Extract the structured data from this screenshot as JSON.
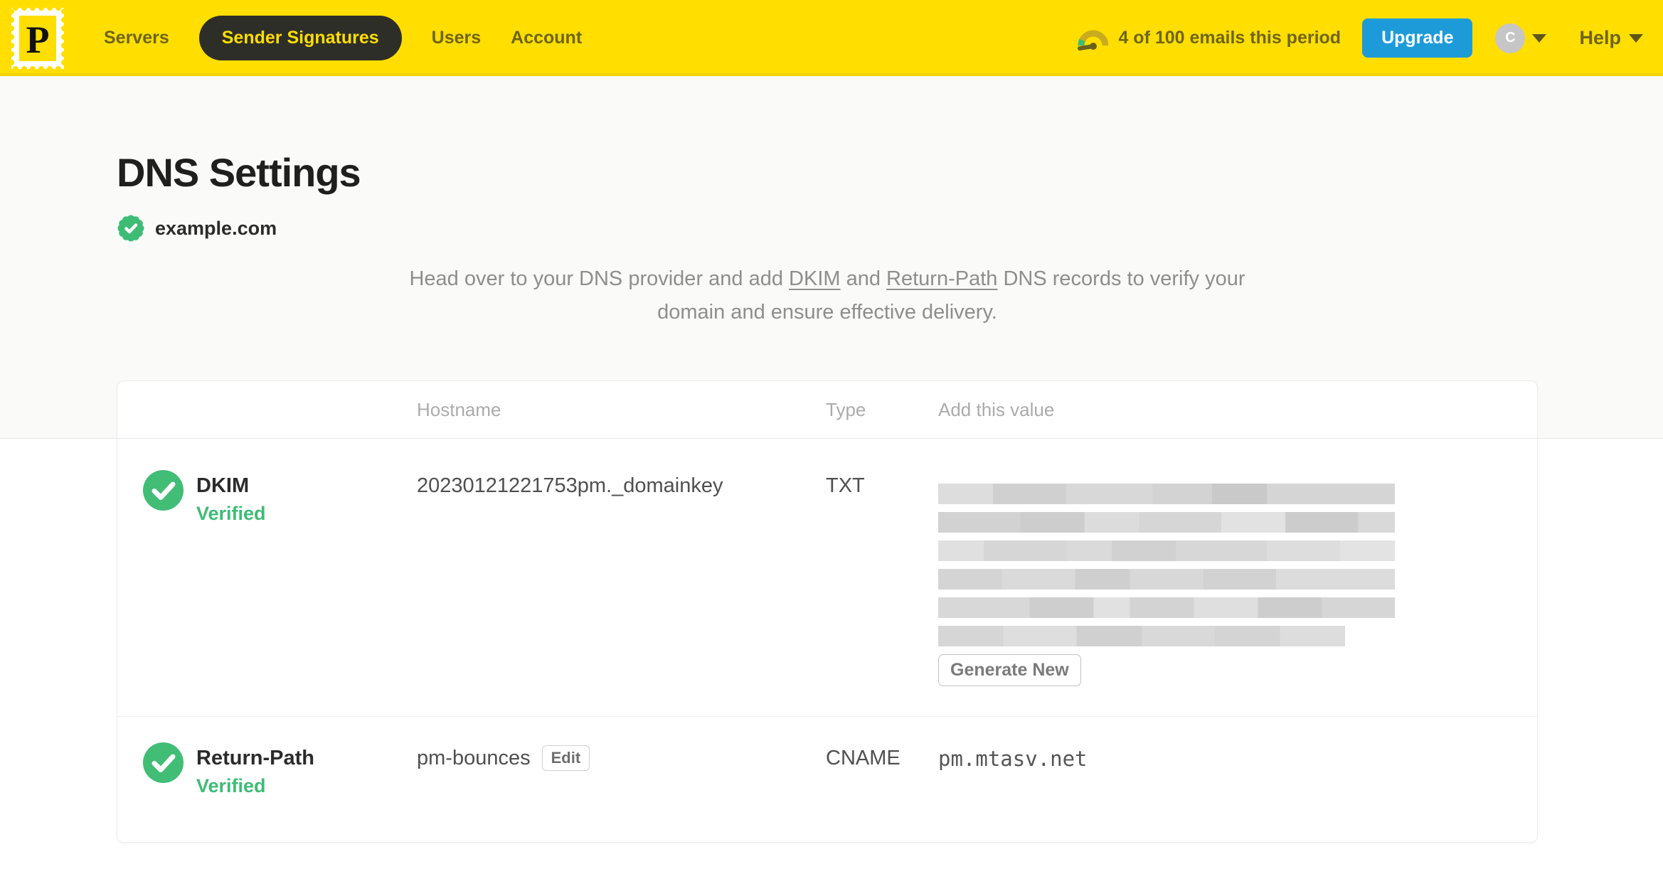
{
  "header": {
    "logo_letter": "P",
    "nav_items": [
      {
        "label": "Servers",
        "active": false
      },
      {
        "label": "Sender Signatures",
        "active": true
      },
      {
        "label": "Users",
        "active": false
      },
      {
        "label": "Account",
        "active": false
      }
    ],
    "usage_text": "4 of 100 emails this period",
    "upgrade_label": "Upgrade",
    "avatar_initial": "C",
    "help_label": "Help"
  },
  "page": {
    "title": "DNS Settings",
    "domain": "example.com",
    "description": {
      "part1": "Head over to your DNS provider and add ",
      "link1": "DKIM",
      "part2": " and ",
      "link2": "Return-Path",
      "part3": " DNS records to verify your domain and ensure effective delivery."
    }
  },
  "table": {
    "headers": {
      "hostname": "Hostname",
      "type": "Type",
      "value": "Add this value"
    },
    "rows": [
      {
        "name": "DKIM",
        "status": "Verified",
        "hostname": "20230121221753pm._domainkey",
        "type": "TXT",
        "value_redacted": true,
        "action_label": "Generate New"
      },
      {
        "name": "Return-Path",
        "status": "Verified",
        "hostname": "pm-bounces",
        "edit_label": "Edit",
        "type": "CNAME",
        "value": "pm.mtasv.net"
      }
    ]
  },
  "colors": {
    "brand_yellow": "#FFDE00",
    "nav_active_bg": "#2E2E29",
    "nav_text": "#6E6519",
    "upgrade_blue": "#1D9BD9",
    "verified_green": "#3EBC76",
    "title_text": "#1F1F1F",
    "muted_gray": "#8E8E8E",
    "redaction_gray": "#D6D6D6"
  }
}
